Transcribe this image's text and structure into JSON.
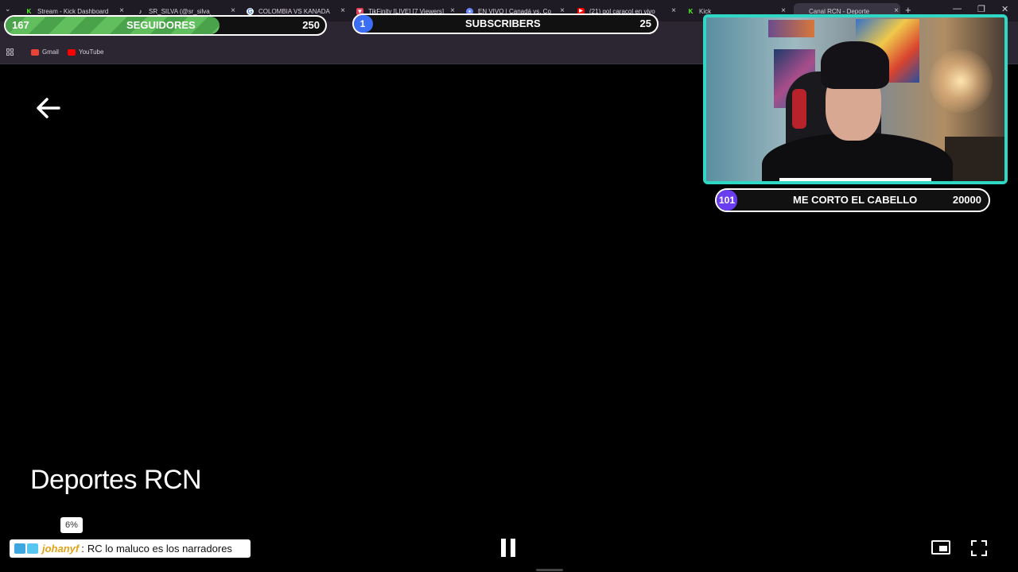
{
  "browser": {
    "tabs": [
      {
        "title": "Stream - Kick Dashboard",
        "favicon": "kick-icon",
        "color": "#53fc18"
      },
      {
        "title": "SR_SILVA (@sr_silva_c",
        "favicon": "tiktok-icon",
        "color": "#ffffff"
      },
      {
        "title": "COLOMBIA VS KANADA",
        "favicon": "google-icon",
        "color": "#4285f4"
      },
      {
        "title": "TikFinity [LIVE] [7 Viewers]",
        "favicon": "tikfinity-icon",
        "color": "#e0405a"
      },
      {
        "title": "EN VIVO | Canadá vs. Col",
        "favicon": "globe-icon",
        "color": "#6a8cff"
      },
      {
        "title": "(21) gol caracol en vivo",
        "favicon": "youtube-icon",
        "color": "#ff0000"
      },
      {
        "title": "Kick",
        "favicon": "kick-icon",
        "color": "#53fc18"
      },
      {
        "title": "Canal RCN - Deporte",
        "favicon": "rcn-icon",
        "color": "#ffffff"
      }
    ],
    "address_fragment": "e4038adf341",
    "bookmarks": [
      {
        "label": "Gmail",
        "color": "#ea4335"
      },
      {
        "label": "YouTube",
        "color": "#ff0000"
      }
    ]
  },
  "overlays": {
    "followers": {
      "current": "167",
      "label": "SEGUIDORES",
      "goal": "250",
      "progress": 0.668
    },
    "subscribers": {
      "current": "1",
      "label": "SUBSCRIBERS",
      "goal": "25",
      "progress": 0.04
    },
    "haircut_goal": {
      "current": "101",
      "label": "ME CORTO EL CABELLO",
      "goal": "20000",
      "progress": 0.005
    },
    "webcam_progress": 0.51
  },
  "player": {
    "channel_title": "Deportes RCN"
  },
  "chat": {
    "percent_badge": "6%",
    "message": {
      "user": "johanyf",
      "separator": ":",
      "text": "RC lo maluco es los narradores"
    }
  },
  "colors": {
    "accent_teal": "#2fd8c4",
    "followers_green": "#4aa34a",
    "subs_blue": "#3b6ef5",
    "goal_purple": "#6a3df0"
  }
}
